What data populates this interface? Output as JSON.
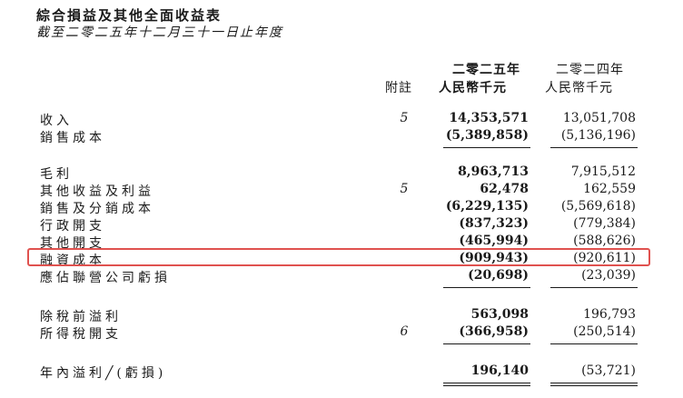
{
  "title": "綜合損益及其他全面收益表",
  "subtitle": "截至二零二五年十二月三十一日止年度",
  "header": {
    "note": "附註",
    "year_current": "二零二五年",
    "year_previous": "二零二四年",
    "unit_current": "人民幣千元",
    "unit_previous": "人民幣千元"
  },
  "rows": [
    {
      "label": "收入",
      "note": "5",
      "current": "14,353,571",
      "previous": "13,051,708"
    },
    {
      "label": "銷售成本",
      "note": "",
      "current": "(5,389,858)",
      "previous": "(5,136,196)"
    },
    {
      "label": "毛利",
      "note": "",
      "current": "8,963,713",
      "previous": "7,915,512"
    },
    {
      "label": "其他收益及利益",
      "note": "5",
      "current": "62,478",
      "previous": "162,559"
    },
    {
      "label": "銷售及分銷成本",
      "note": "",
      "current": "(6,229,135)",
      "previous": "(5,569,618)"
    },
    {
      "label": "行政開支",
      "note": "",
      "current": "(837,323)",
      "previous": "(779,384)"
    },
    {
      "label": "其他開支",
      "note": "",
      "current": "(465,994)",
      "previous": "(588,626)"
    },
    {
      "label": "融資成本",
      "note": "",
      "current": "(909,943)",
      "previous": "(920,611)"
    },
    {
      "label": "應佔聯營公司虧損",
      "note": "",
      "current": "(20,698)",
      "previous": "(23,039)"
    },
    {
      "label": "除稅前溢利",
      "note": "",
      "current": "563,098",
      "previous": "196,793"
    },
    {
      "label": "所得稅開支",
      "note": "6",
      "current": "(366,958)",
      "previous": "(250,514)"
    },
    {
      "label": "年內溢利╱(虧損)",
      "note": "",
      "current": "196,140",
      "previous": "(53,721)"
    }
  ]
}
